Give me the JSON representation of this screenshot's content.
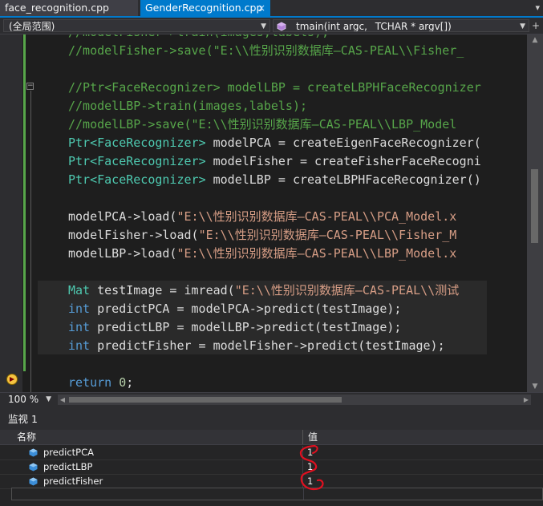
{
  "tabs": [
    {
      "label": "face_recognition.cpp",
      "active": false
    },
    {
      "label": "GenderRecognition.cpp",
      "active": true,
      "close": "×"
    }
  ],
  "nav": {
    "scope": "(全局范围)",
    "function": "_tmain(int argc, _TCHAR * argv[])"
  },
  "code": {
    "line0": {
      "c": "//modelFisher->train(images,labels);"
    },
    "line1": {
      "c": "//modelFisher->save(\"E:\\\\性别识别数据库—CAS-PEAL\\\\Fisher_"
    },
    "line3": {
      "c": "//Ptr<FaceRecognizer> modelLBP = createLBPHFaceRecognizer"
    },
    "line4": {
      "c": "//modelLBP->train(images,labels);"
    },
    "line5": {
      "c": "//modelLBP->save(\"E:\\\\性别识别数据库—CAS-PEAL\\\\LBP_Model"
    },
    "line6": {
      "t1": "Ptr<",
      "t2": "FaceRecognizer",
      "t3": ">",
      "rest": " modelPCA = createEigenFaceRecognizer("
    },
    "line7": {
      "t1": "Ptr<",
      "t2": "FaceRecognizer",
      "t3": ">",
      "rest": " modelFisher = createFisherFaceRecogni"
    },
    "line8": {
      "t1": "Ptr<",
      "t2": "FaceRecognizer",
      "t3": ">",
      "rest": " modelLBP = createLBPHFaceRecognizer()"
    },
    "line10": {
      "pre": "modelPCA->load(",
      "s": "\"E:\\\\性别识别数据库—CAS-PEAL\\\\PCA_Model.x"
    },
    "line11": {
      "pre": "modelFisher->load(",
      "s": "\"E:\\\\性别识别数据库—CAS-PEAL\\\\Fisher_M"
    },
    "line12": {
      "pre": "modelLBP->load(",
      "s": "\"E:\\\\性别识别数据库—CAS-PEAL\\\\LBP_Model.x"
    },
    "line14": {
      "t": "Mat",
      "pre": " testImage = imread(",
      "s": "\"E:\\\\性别识别数据库—CAS-PEAL\\\\测试"
    },
    "line15": {
      "k": "int",
      "rest": " predictPCA = modelPCA->predict(testImage);"
    },
    "line16": {
      "k": "int",
      "rest": " predictLBP = modelLBP->predict(testImage);"
    },
    "line17": {
      "k": "int",
      "rest": " predictFisher = modelFisher->predict(testImage);"
    },
    "line19": {
      "k": "return",
      "sp": " ",
      "n": "0",
      "end": ";"
    }
  },
  "zoom": "100 %",
  "watch": {
    "title": "监视 1",
    "col_name": "名称",
    "col_value": "值",
    "rows": [
      {
        "name": "predictPCA",
        "value": "1"
      },
      {
        "name": "predictLBP",
        "value": "1"
      },
      {
        "name": "predictFisher",
        "value": "1"
      }
    ]
  },
  "colors": {
    "accent": "#007acc",
    "comment": "#57a64a",
    "type": "#4ec9b0",
    "keyword": "#569cd6",
    "string": "#d69d85",
    "annotation": "#e01020"
  },
  "icons": {
    "function": "function-cube-icon",
    "variable": "variable-cube-icon",
    "execution": "current-statement-arrow-icon"
  }
}
